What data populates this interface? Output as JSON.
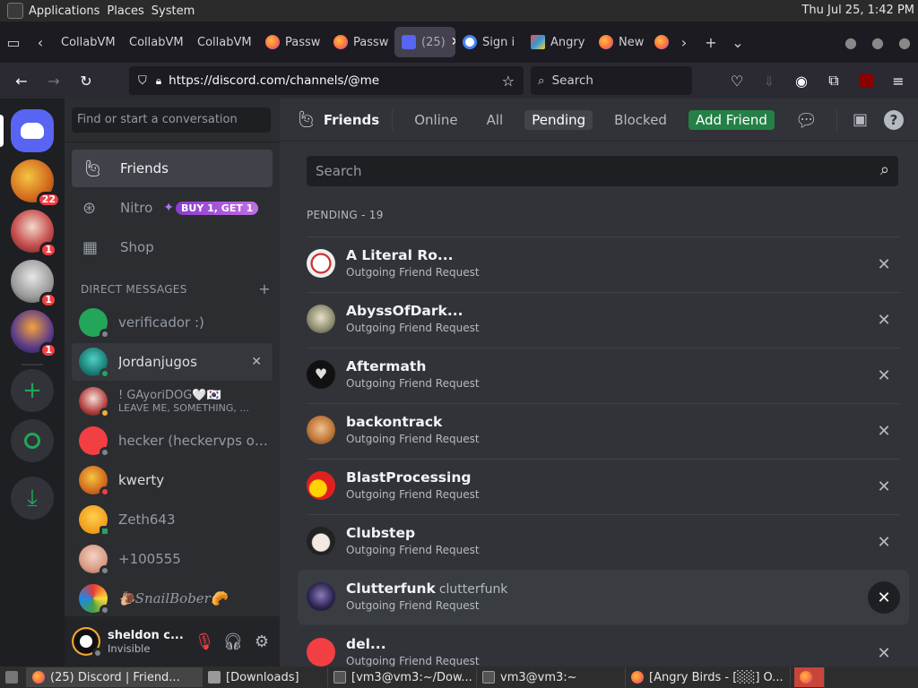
{
  "gnome": {
    "menus": [
      "Applications",
      "Places",
      "System"
    ],
    "clock": "Thu Jul 25,  1:42 PM"
  },
  "tabs": [
    {
      "label": "CollabVM"
    },
    {
      "label": "CollabVM"
    },
    {
      "label": "CollabVM"
    },
    {
      "label": "Passw"
    },
    {
      "label": "Passw"
    },
    {
      "label": "(25)",
      "active": true
    },
    {
      "label": "Sign i"
    },
    {
      "label": "Angry"
    },
    {
      "label": "New"
    }
  ],
  "browser": {
    "url": "https://discord.com/channels/@me",
    "search_placeholder": "Search"
  },
  "guild_badges": [
    "22",
    "1",
    "1",
    "1"
  ],
  "dm": {
    "search_placeholder": "Find or start a conversation",
    "nav": [
      {
        "label": "Friends"
      },
      {
        "label": "Nitro",
        "promo": "BUY 1, GET 1"
      },
      {
        "label": "Shop"
      }
    ],
    "header": "DIRECT MESSAGES",
    "rows": [
      {
        "name": "verificador :)",
        "sub": ""
      },
      {
        "name": "Jordanjugos",
        "sub": ""
      },
      {
        "name": "!      GAyoriDOG🤍🇰🇷",
        "sub": "LEAVE ME, SOMETHING, ..."
      },
      {
        "name": "hecker (heckervps ow...",
        "sub": ""
      },
      {
        "name": "kwerty",
        "sub": ""
      },
      {
        "name": "Zeth643",
        "sub": ""
      },
      {
        "name": "+100555",
        "sub": ""
      },
      {
        "name": "🐌SnailBober🥐",
        "sub": ""
      }
    ]
  },
  "user": {
    "name": "sheldon c...",
    "status": "Invisible"
  },
  "topbar": {
    "title": "Friends",
    "tabs": [
      "Online",
      "All",
      "Pending",
      "Blocked"
    ],
    "add_friend": "Add Friend"
  },
  "friends": {
    "search_placeholder": "Search",
    "pending_label": "PENDING - 19",
    "rows": [
      {
        "name": "A Literal Ro...",
        "username": "",
        "sub": "Outgoing Friend Request"
      },
      {
        "name": "AbyssOfDark...",
        "username": "",
        "sub": "Outgoing Friend Request"
      },
      {
        "name": "Aftermath",
        "username": "",
        "sub": "Outgoing Friend Request"
      },
      {
        "name": "backontrack",
        "username": "",
        "sub": "Outgoing Friend Request"
      },
      {
        "name": "BlastProcessing",
        "username": "",
        "sub": "Outgoing Friend Request"
      },
      {
        "name": "Clubstep",
        "username": "",
        "sub": "Outgoing Friend Request"
      },
      {
        "name": "Clutterfunk",
        "username": "clutterfunk",
        "sub": "Outgoing Friend Request"
      },
      {
        "name": "del...",
        "username": "",
        "sub": "Outgoing Friend Request"
      }
    ]
  },
  "taskbar": [
    {
      "label": "(25) Discord | Friend..."
    },
    {
      "label": "[Downloads]"
    },
    {
      "label": "[vm3@vm3:~/Dow..."
    },
    {
      "label": "vm3@vm3:~"
    },
    {
      "label": "[Angry Birds - [░░] O..."
    }
  ]
}
